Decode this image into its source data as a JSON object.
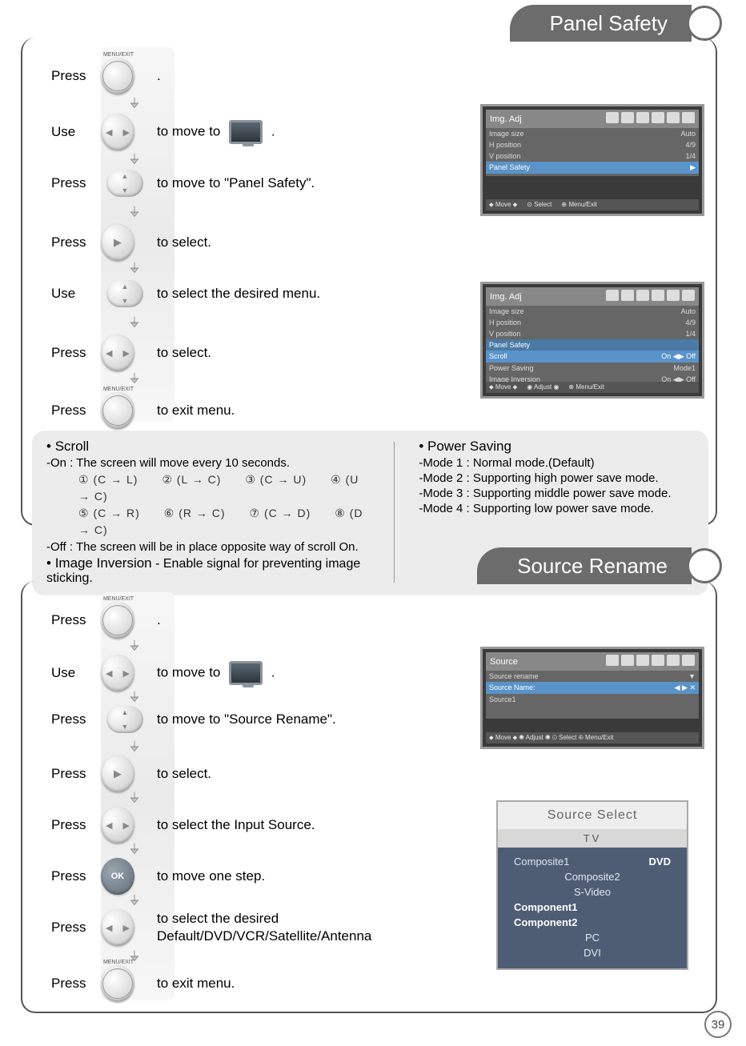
{
  "page_number": "39",
  "sections": {
    "panel_safety": {
      "title": "Panel Safety",
      "steps": [
        {
          "verb": "Press",
          "icon": "menu-exit",
          "text": "."
        },
        {
          "verb": "Use",
          "icon": "lr",
          "text_pre": "to move to",
          "text_post": "."
        },
        {
          "verb": "Press",
          "icon": "ud",
          "text": "to move to \"Panel Safety\"."
        },
        {
          "verb": "Press",
          "icon": "right",
          "text": "to select."
        },
        {
          "verb": "Use",
          "icon": "ud",
          "text": "to select the desired menu."
        },
        {
          "verb": "Press",
          "icon": "lr",
          "text": "to select."
        },
        {
          "verb": "Press",
          "icon": "menu-exit",
          "text": "to exit menu."
        }
      ],
      "osd1": {
        "header": "Img. Adj",
        "rows": [
          {
            "l": "Image size",
            "r": "Auto"
          },
          {
            "l": "H position",
            "r": "4/9"
          },
          {
            "l": "V position",
            "r": "1/4"
          },
          {
            "l": "Panel Safety",
            "r": "▶",
            "hl": true
          }
        ],
        "footer": [
          "⬥ Move ⬥",
          "⊙ Select",
          "⊕ Menu/Exit"
        ]
      },
      "osd2": {
        "header": "Img. Adj",
        "rows": [
          {
            "l": "Image size",
            "r": "Auto"
          },
          {
            "l": "H position",
            "r": "4/9"
          },
          {
            "l": "V position",
            "r": "1/4"
          },
          {
            "l": "Panel Safety",
            "r": ""
          },
          {
            "l": "Scroll",
            "r": "On ◀▶ Off",
            "hl": true
          },
          {
            "l": "Power Saving",
            "r": "Mode1"
          },
          {
            "l": "Image Inversion",
            "r": "On ◀▶ Off"
          }
        ],
        "footer": [
          "⬥ Move ⬥",
          "◉ Adjust ◉",
          "⊕ Menu/Exit"
        ]
      },
      "info_left": {
        "scroll_title": "Scroll",
        "scroll_on": "-On : The screen will move every 10 seconds.",
        "seq_a": "① (C → L)  ② (L → C)  ③ (C → U)  ④ (U → C)",
        "seq_b": "⑤ (C → R)  ⑥ (R → C)  ⑦ (C → D)  ⑧ (D → C)",
        "scroll_off": "-Off : The screen will be in place opposite way of scroll On.",
        "inversion_title": "Image Inversion",
        "inversion_text": "- Enable signal for preventing image sticking."
      },
      "info_right": {
        "power_title": "Power Saving",
        "m1": "-Mode 1 : Normal mode.(Default)",
        "m2": "-Mode 2 : Supporting high power save mode.",
        "m3": "-Mode 3 : Supporting middle power save mode.",
        "m4": "-Mode 4 : Supporting low power save mode."
      }
    },
    "source_rename": {
      "title": "Source Rename",
      "steps": [
        {
          "verb": "Press",
          "icon": "menu-exit",
          "text": "."
        },
        {
          "verb": "Use",
          "icon": "lr",
          "text_pre": "to move to",
          "text_post": "."
        },
        {
          "verb": "Press",
          "icon": "ud",
          "text": "to move to \"Source Rename\"."
        },
        {
          "verb": "Press",
          "icon": "right",
          "text": "to select."
        },
        {
          "verb": "Press",
          "icon": "lr",
          "text": "to select the Input Source."
        },
        {
          "verb": "Press",
          "icon": "ok",
          "text": "to move one step."
        },
        {
          "verb": "Press",
          "icon": "lr",
          "text": "to select the desired Default/DVD/VCR/Satellite/Antenna"
        },
        {
          "verb": "Press",
          "icon": "menu-exit",
          "text": "to exit menu."
        }
      ],
      "osd1": {
        "header": "Source",
        "rows": [
          {
            "l": "Source rename",
            "r": "▼"
          },
          {
            "l": "Source Name:",
            "r": "◀   ▶   ✕",
            "hl": true
          },
          {
            "l": "Source1",
            "r": ""
          }
        ],
        "footer": [
          "⬥ Move ⬥ ◉ Adjust ◉ ⊙ Select ⊕ Menu/Exit"
        ]
      },
      "source_select": {
        "title": "Source Select",
        "tv": "TV",
        "rows": [
          {
            "l": "Composite1",
            "r": "DVD"
          },
          {
            "l": "Composite2",
            "r": ""
          },
          {
            "l": "S-Video",
            "r": ""
          },
          {
            "l": "Component1",
            "r": ""
          },
          {
            "l": "Component2",
            "r": ""
          },
          {
            "l": "PC",
            "r": ""
          },
          {
            "l": "DVI",
            "r": ""
          }
        ]
      }
    }
  }
}
